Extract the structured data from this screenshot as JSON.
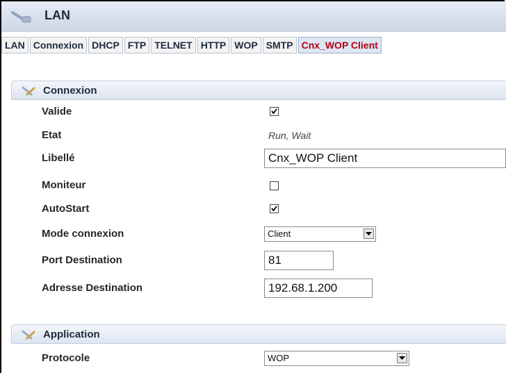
{
  "window": {
    "title": "LAN"
  },
  "tabs": [
    {
      "label": "LAN",
      "active": false
    },
    {
      "label": "Connexion",
      "active": false
    },
    {
      "label": "DHCP",
      "active": false
    },
    {
      "label": "FTP",
      "active": false
    },
    {
      "label": "TELNET",
      "active": false
    },
    {
      "label": "HTTP",
      "active": false
    },
    {
      "label": "WOP",
      "active": false
    },
    {
      "label": "SMTP",
      "active": false
    },
    {
      "label": "Cnx_WOP Client",
      "active": true
    }
  ],
  "connexion": {
    "title": "Connexion",
    "valide": {
      "label": "Valide",
      "checked": true
    },
    "etat": {
      "label": "Etat",
      "value": "Run, Wait"
    },
    "libelle": {
      "label": "Libellé",
      "value": "Cnx_WOP Client"
    },
    "moniteur": {
      "label": "Moniteur",
      "checked": false
    },
    "autostart": {
      "label": "AutoStart",
      "checked": true
    },
    "mode": {
      "label": "Mode connexion",
      "value": "Client"
    },
    "port": {
      "label": "Port Destination",
      "value": "81"
    },
    "adresse": {
      "label": "Adresse Destination",
      "value": "192.68.1.200"
    }
  },
  "application": {
    "title": "Application",
    "protocole": {
      "label": "Protocole",
      "value": "WOP"
    }
  },
  "colors": {
    "active_tab_text": "#b30015",
    "header_bg": "#dde5f0"
  }
}
